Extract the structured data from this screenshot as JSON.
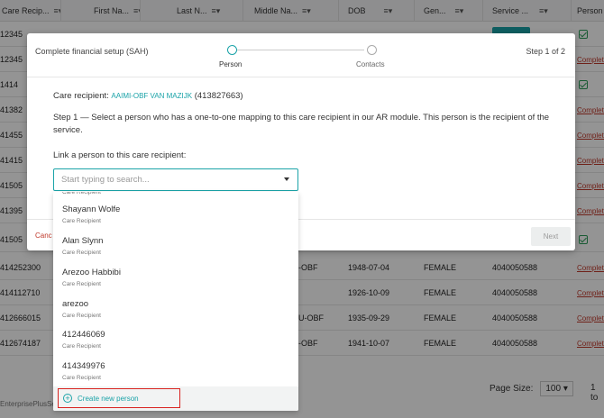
{
  "table": {
    "headers": [
      "Care Recip...",
      "First Na...",
      "Last N...",
      "Middle Na...",
      "DOB",
      "Gen...",
      "Service ...",
      "Person"
    ],
    "rows": [
      {
        "id": "12345",
        "middle": "",
        "dob": "",
        "gender": "",
        "service": "",
        "person": "check"
      },
      {
        "id": "12345",
        "middle": "",
        "dob": "",
        "gender": "",
        "service": "",
        "person": "Complete"
      },
      {
        "id": "1414",
        "middle": "",
        "dob": "",
        "gender": "",
        "service": "",
        "person": "check"
      },
      {
        "id": "41382",
        "middle": "",
        "dob": "",
        "gender": "",
        "service": "",
        "person": "Complete"
      },
      {
        "id": "41455",
        "middle": "",
        "dob": "",
        "gender": "",
        "service": "",
        "person": "Complete"
      },
      {
        "id": "41415",
        "middle": "",
        "dob": "",
        "gender": "",
        "service": "",
        "person": "Complete"
      },
      {
        "id": "41505",
        "middle": "",
        "dob": "",
        "gender": "",
        "service": "",
        "person": "Complete"
      },
      {
        "id": "41395",
        "middle": "",
        "dob": "",
        "gender": "",
        "service": "",
        "person": "Complete"
      },
      {
        "id": "41505",
        "middle": "",
        "dob": "",
        "gender": "",
        "service": "",
        "person": "check"
      },
      {
        "id": "414252300",
        "middle": "-OBF",
        "dob": "1948-07-04",
        "gender": "FEMALE",
        "service": "4040050588",
        "person": "Complete"
      },
      {
        "id": "414112710",
        "middle": "",
        "dob": "1926-10-09",
        "gender": "FEMALE",
        "service": "4040050588",
        "person": "Complete"
      },
      {
        "id": "412666015",
        "middle": "U-OBF",
        "dob": "1935-09-29",
        "gender": "FEMALE",
        "service": "4040050588",
        "person": "Complete"
      },
      {
        "id": "412674187",
        "middle": "-OBF",
        "dob": "1941-10-07",
        "gender": "FEMALE",
        "service": "4040050588",
        "person": "Complete"
      }
    ],
    "complete_label": "Complete",
    "page_size_label": "Page Size:",
    "page_size_value": "100",
    "range_text": "1 to",
    "footer_text": "EnterprisePlusSe"
  },
  "modal": {
    "title": "Complete financial setup (SAH)",
    "step_indicator": "Step 1 of 2",
    "steps": [
      "Person",
      "Contacts"
    ],
    "recipient_label": "Care recipient:",
    "recipient_name": "AAIMI-OBF VAN MAZIJK",
    "recipient_id": "(413827663)",
    "description": "Step 1 — Select a person who has a one-to-one mapping to this care recipient in our AR module. This person is the recipient of the service.",
    "link_label": "Link a person to this care recipient:",
    "search_placeholder": "Start typing to search...",
    "cancel_label": "Canc",
    "next_label": "Next"
  },
  "dropdown": {
    "partial_type": "Care Recipient",
    "options": [
      {
        "name": "Shayann Wolfe",
        "type": "Care Recipient"
      },
      {
        "name": "Alan Slynn",
        "type": "Care Recipient"
      },
      {
        "name": "Arezoo Habbibi",
        "type": "Care Recipient"
      },
      {
        "name": "arezoo",
        "type": "Care Recipient"
      },
      {
        "name": "412446069",
        "type": "Care Recipient"
      },
      {
        "name": "414349976",
        "type": "Care Recipient"
      }
    ],
    "create_label": "Create new person"
  },
  "colors": {
    "accent": "#1aa3a8",
    "danger": "#c0392b",
    "highlight_border": "#d9231f"
  },
  "icons": [
    "filter-menu-icon",
    "checkbox-checked-icon",
    "caret-down-icon",
    "plus-circle-icon",
    "step-dot-icon"
  ]
}
